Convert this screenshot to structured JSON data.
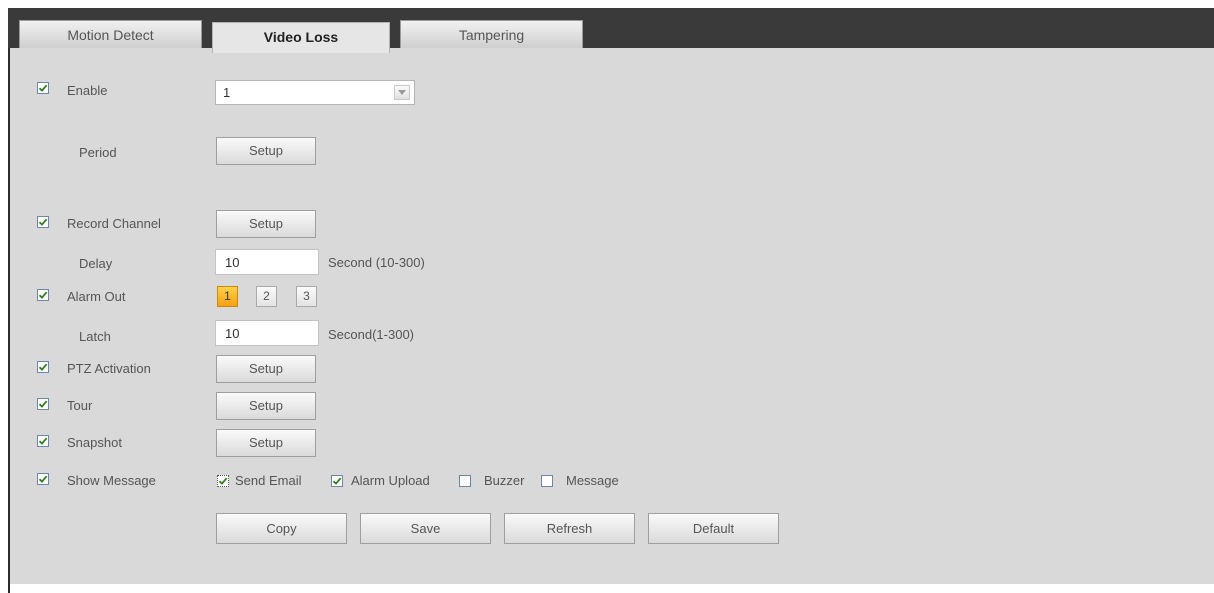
{
  "tabs": [
    {
      "label": "Motion Detect",
      "active": false
    },
    {
      "label": "Video Loss",
      "active": true
    },
    {
      "label": "Tampering",
      "active": false
    }
  ],
  "enable": {
    "label": "Enable",
    "checked": true,
    "channel_value": "1"
  },
  "period": {
    "label": "Period",
    "button": "Setup"
  },
  "record_channel": {
    "label": "Record Channel",
    "checked": true,
    "button": "Setup"
  },
  "delay": {
    "label": "Delay",
    "value": "10",
    "unit": "Second (10-300)"
  },
  "alarm_out": {
    "label": "Alarm Out",
    "checked": true,
    "outputs": [
      "1",
      "2",
      "3"
    ],
    "selected": "1"
  },
  "latch": {
    "label": "Latch",
    "value": "10",
    "unit": "Second(1-300)"
  },
  "ptz_activation": {
    "label": "PTZ Activation",
    "checked": true,
    "button": "Setup"
  },
  "tour": {
    "label": "Tour",
    "checked": true,
    "button": "Setup"
  },
  "snapshot": {
    "label": "Snapshot",
    "checked": true,
    "button": "Setup"
  },
  "show_message": {
    "label": "Show Message",
    "checked": true,
    "options": [
      {
        "label": "Send Email",
        "checked": true
      },
      {
        "label": "Alarm Upload",
        "checked": true
      },
      {
        "label": "Buzzer",
        "checked": false
      },
      {
        "label": "Message",
        "checked": false
      }
    ]
  },
  "actions": {
    "copy": "Copy",
    "save": "Save",
    "refresh": "Refresh",
    "default": "Default"
  },
  "colors": {
    "checkmark": "#2f7d22",
    "tab_bar": "#3a3a3a",
    "panel": "#d9d9d9",
    "selected_output": "#f5a10f"
  }
}
